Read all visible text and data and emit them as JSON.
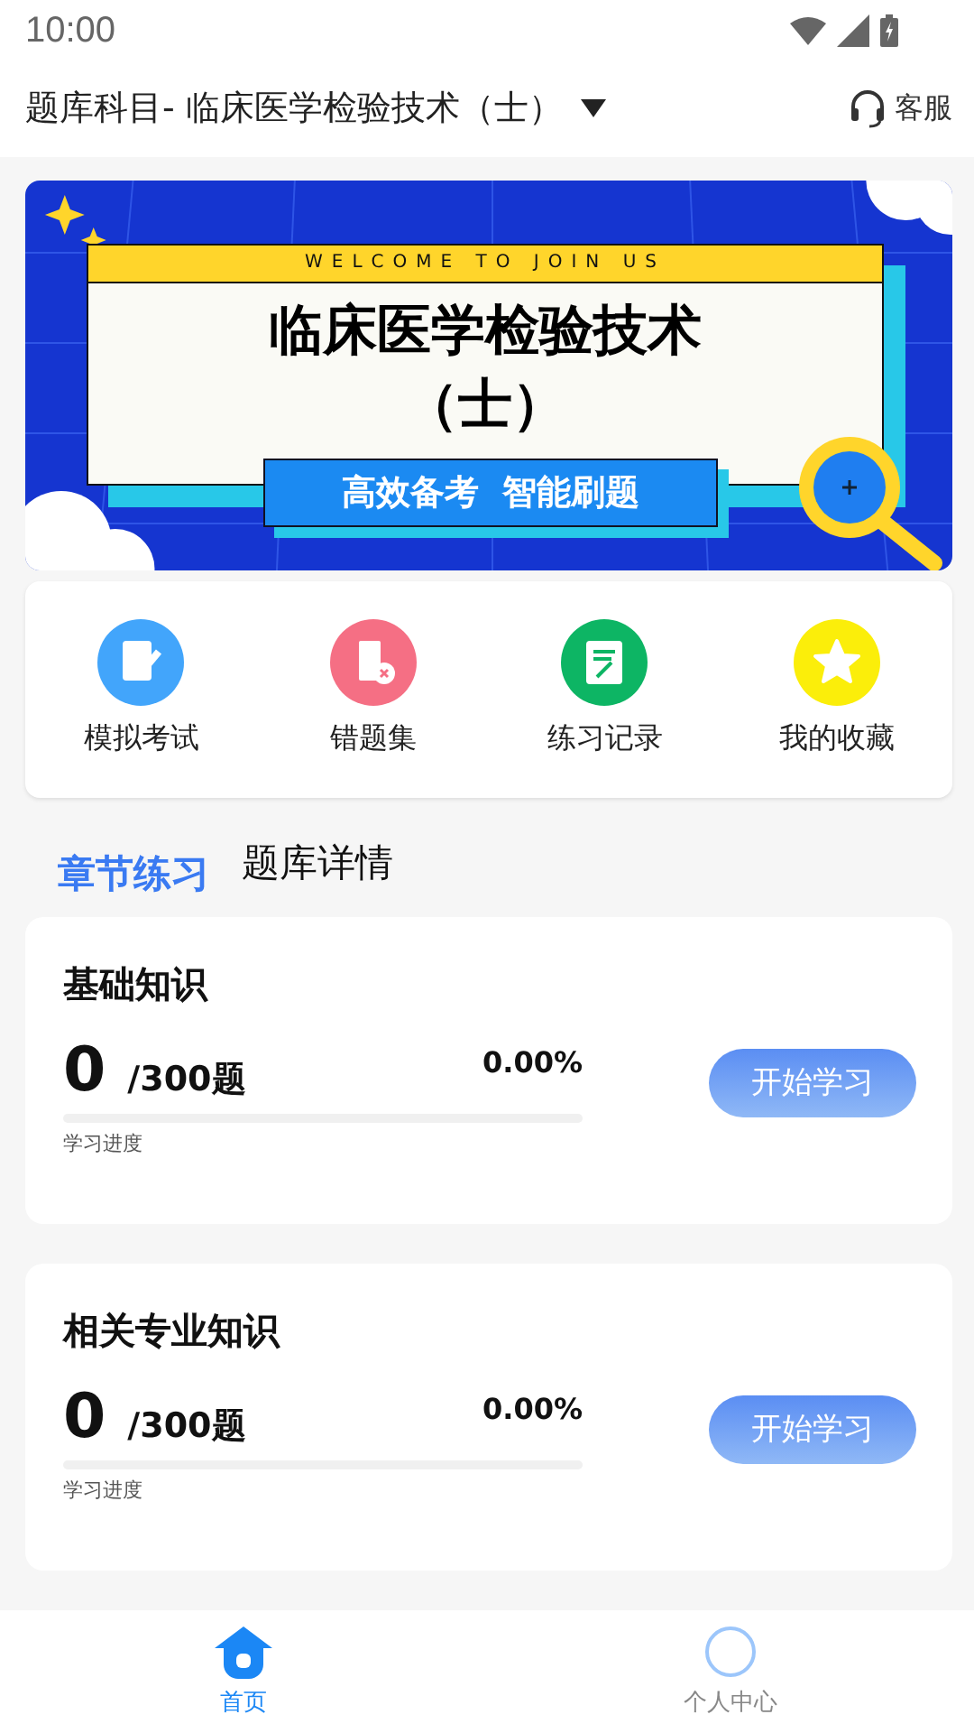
{
  "status_bar": {
    "time": "10:00"
  },
  "header": {
    "subject_label": "题库科目- 临床医学检验技术（士）",
    "service": "客服"
  },
  "banner": {
    "tagline": "WELCOME TO JOIN US",
    "title": "临床医学检验技术",
    "subtitle": "（士）",
    "slogan": "高效备考  智能刷题"
  },
  "shortcuts": [
    {
      "label": "模拟考试",
      "kind": "exam",
      "color": "#42a5fb"
    },
    {
      "label": "错题集",
      "kind": "mistakes",
      "color": "#f56f84"
    },
    {
      "label": "练习记录",
      "kind": "record",
      "color": "#0db564"
    },
    {
      "label": "我的收藏",
      "kind": "favorite",
      "color": "#fbee0a"
    }
  ],
  "tabs": [
    {
      "label": "章节练习",
      "selected": true
    },
    {
      "label": "题库详情",
      "selected": false
    }
  ],
  "chapters": [
    {
      "title": "基础知识",
      "done": "0",
      "total": "/300题",
      "percent": "0.00%",
      "level": 0,
      "progress_label": "学习进度",
      "button": "开始学习"
    },
    {
      "title": "相关专业知识",
      "done": "0",
      "total": "/300题",
      "percent": "0.00%",
      "level": 0,
      "progress_label": "学习进度",
      "button": "开始学习"
    }
  ],
  "bottom_nav": [
    {
      "label": "首页",
      "kind": "home",
      "selected": true
    },
    {
      "label": "个人中心",
      "kind": "profile",
      "selected": false
    }
  ]
}
